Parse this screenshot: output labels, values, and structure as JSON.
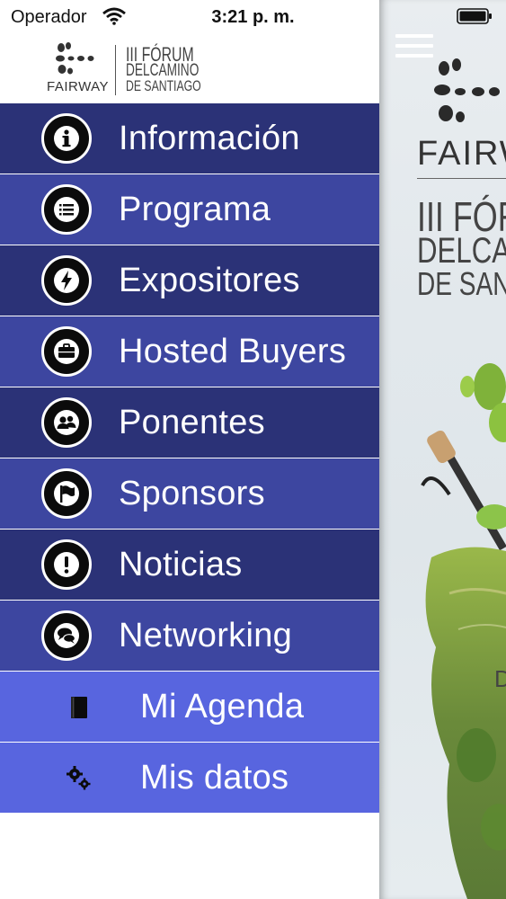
{
  "status_bar": {
    "carrier": "Operador",
    "time": "3:21 p. m.",
    "wifi_icon": "wifi-icon",
    "battery_icon": "battery-icon"
  },
  "header": {
    "logo_brand": "FAIRWAY",
    "logo_line1": "III FÓRUM",
    "logo_line2": "DELCAMINO",
    "logo_line3": "DE SANTIAGO"
  },
  "menu": {
    "items": [
      {
        "label": "Información",
        "icon": "info-icon"
      },
      {
        "label": "Programa",
        "icon": "list-icon"
      },
      {
        "label": "Expositores",
        "icon": "lightning-icon"
      },
      {
        "label": "Hosted Buyers",
        "icon": "briefcase-icon"
      },
      {
        "label": "Ponentes",
        "icon": "users-icon"
      },
      {
        "label": "Sponsors",
        "icon": "flag-icon"
      },
      {
        "label": "Noticias",
        "icon": "exclamation-icon"
      },
      {
        "label": "Networking",
        "icon": "chat-icon"
      },
      {
        "label": "Mi Agenda",
        "icon": "book-icon"
      },
      {
        "label": "Mis datos",
        "icon": "gears-icon"
      }
    ]
  },
  "background_screen": {
    "menu_icon": "hamburger-icon",
    "brand": "FAIRWAY",
    "forum_line1": "III FÓRUM",
    "forum_line2": "DELCAMINO",
    "forum_line3": "DE SANTIAGO",
    "date_fragment": "D"
  },
  "colors": {
    "menu_dark": "#2b3277",
    "menu_mid": "#3d46a0",
    "menu_light": "#5865df"
  }
}
